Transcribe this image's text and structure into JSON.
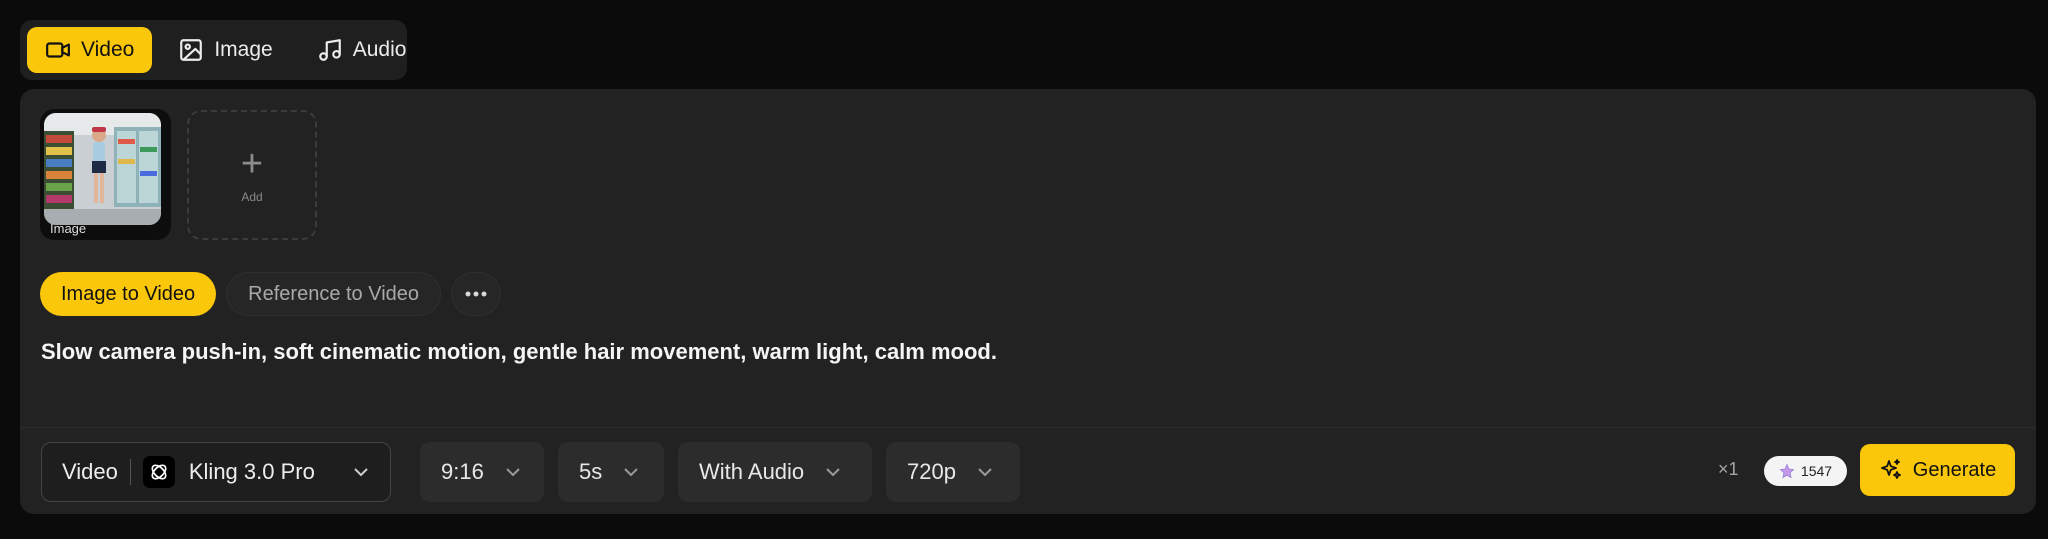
{
  "mode_tabs": [
    {
      "label": "Video",
      "icon": "video-camera-icon",
      "active": true
    },
    {
      "label": "Image",
      "icon": "image-icon",
      "active": false
    },
    {
      "label": "Audio",
      "icon": "music-note-icon",
      "active": false
    }
  ],
  "media": {
    "thumb_label": "Image",
    "add_label": "Add",
    "add_icon": "plus-icon"
  },
  "chips": {
    "image_to_video": "Image to Video",
    "reference_to_video": "Reference to Video",
    "more_icon": "more-dots-icon"
  },
  "prompt": "Slow camera push-in, soft cinematic motion, gentle hair movement, warm light, calm mood.",
  "toolbar": {
    "category": "Video",
    "model": "Kling 3.0 Pro",
    "aspect_ratio": "9:16",
    "duration": "5s",
    "audio": "With Audio",
    "resolution": "720p",
    "multiplier": "×1",
    "credits": "1547",
    "generate_label": "Generate"
  },
  "colors": {
    "accent": "#fbc70b",
    "background": "#0b0b0b",
    "card": "#222222"
  }
}
